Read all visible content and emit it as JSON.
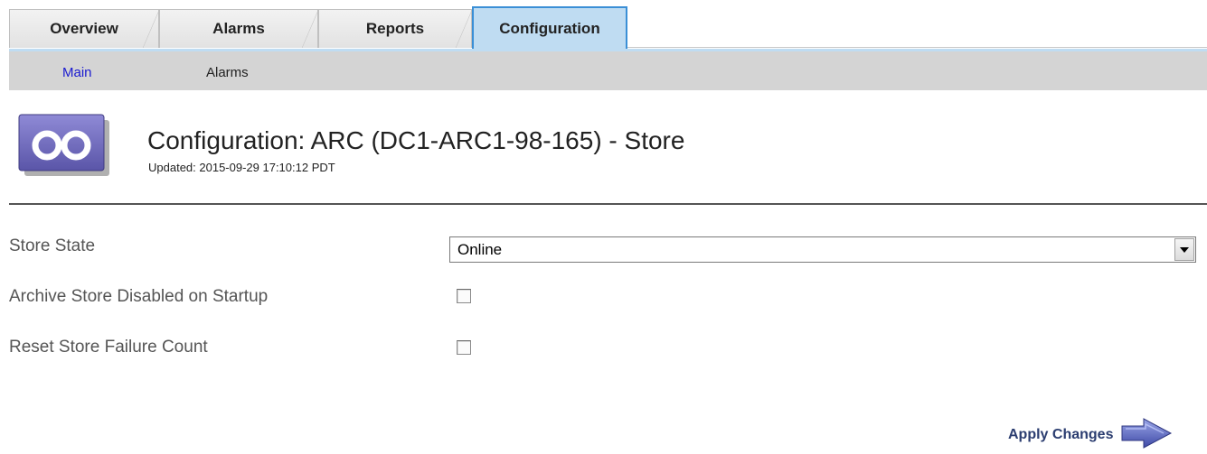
{
  "tabs": [
    {
      "label": "Overview",
      "active": false
    },
    {
      "label": "Alarms",
      "active": false
    },
    {
      "label": "Reports",
      "active": false
    },
    {
      "label": "Configuration",
      "active": true
    }
  ],
  "subnav": [
    {
      "label": "Main",
      "active": true
    },
    {
      "label": "Alarms",
      "active": false
    }
  ],
  "header": {
    "icon": "archive-node-icon",
    "title": "Configuration: ARC (DC1-ARC1-98-165) - Store",
    "updated": "Updated: 2015-09-29 17:10:12 PDT"
  },
  "form": {
    "store_state": {
      "label": "Store State",
      "value": "Online"
    },
    "archive_disabled": {
      "label": "Archive Store Disabled on Startup",
      "checked": false
    },
    "reset_failure": {
      "label": "Reset Store Failure Count",
      "checked": false
    }
  },
  "apply": {
    "label": "Apply Changes",
    "icon": "arrow-right-icon"
  },
  "colors": {
    "active_tab": "#bfdcf2",
    "active_tab_border": "#3a8fd6",
    "subnav_bg": "#d4d4d4",
    "link": "#1a1ad0",
    "icon_purple": "#6a64b8"
  }
}
